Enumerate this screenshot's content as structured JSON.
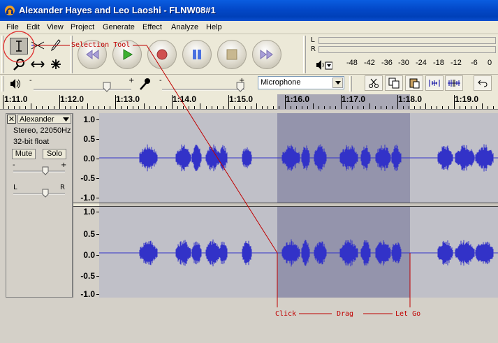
{
  "window": {
    "title": "Alexander Hayes and Leo Laoshi - FLNW08#1"
  },
  "menu": [
    "File",
    "Edit",
    "View",
    "Project",
    "Generate",
    "Effect",
    "Analyze",
    "Help"
  ],
  "tools": [
    "selection-tool",
    "envelope-tool",
    "draw-tool",
    "zoom-tool",
    "timeshift-tool",
    "multi-tool"
  ],
  "transport": [
    "skip-start",
    "play",
    "record",
    "pause",
    "stop",
    "skip-end"
  ],
  "meter": {
    "channels": [
      "L",
      "R"
    ],
    "scale": [
      "-48",
      "-42",
      "-36",
      "-30",
      "-24",
      "-18",
      "-12",
      "-6",
      "0"
    ]
  },
  "mixer": {
    "input_source": "Microphone",
    "output_volume": 0.75,
    "input_volume": 0.95
  },
  "ruler": {
    "labels": [
      "1:11.0",
      "1:12.0",
      "1:13.0",
      "1:14.0",
      "1:15.0",
      "1:16.0",
      "1:17.0",
      "1:18.0",
      "1:19.0"
    ]
  },
  "track": {
    "name": "Alexander",
    "format": "Stereo, 22050Hz",
    "bitdepth": "32-bit float",
    "mute_label": "Mute",
    "solo_label": "Solo",
    "gain_minus": "-",
    "gain_plus": "+",
    "pan_left": "L",
    "pan_right": "R",
    "scale_labels": [
      "1.0",
      "0.5",
      "0.0",
      "-0.5",
      "-1.0"
    ]
  },
  "annotations": {
    "selection_tool": "Selection Tool",
    "click": "Click",
    "drag": "Drag",
    "let_go": "Let Go"
  },
  "colors": {
    "waveform": "#3232c8",
    "selection": "#9494ac",
    "annotation": "#c00000"
  }
}
